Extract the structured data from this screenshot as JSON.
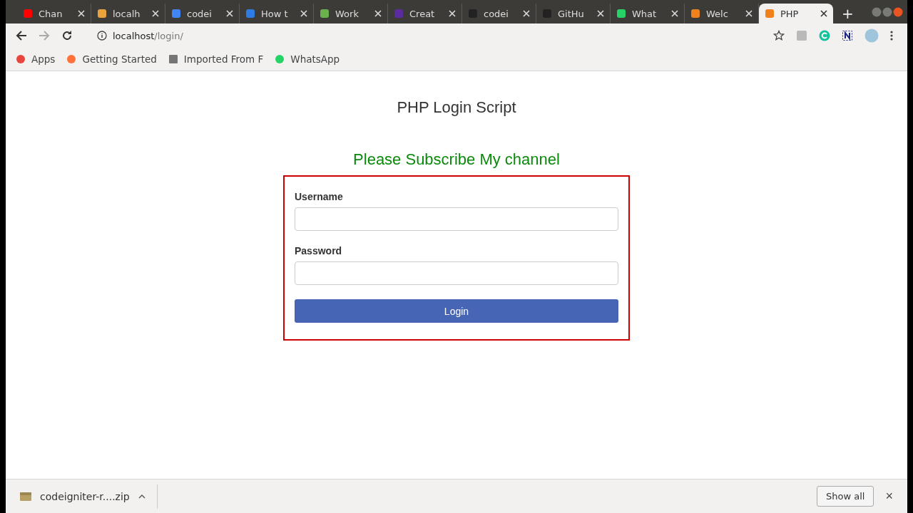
{
  "tabs": [
    {
      "title": "Chan",
      "color": "#ff0000",
      "selected": false
    },
    {
      "title": "localh",
      "color": "#e8a33d",
      "selected": false
    },
    {
      "title": "codei",
      "color": "#4285f4",
      "selected": false
    },
    {
      "title": "How t",
      "color": "#2d7be5",
      "selected": false
    },
    {
      "title": "Work",
      "color": "#6ab04c",
      "selected": false
    },
    {
      "title": "Creat",
      "color": "#5b2c9f",
      "selected": false
    },
    {
      "title": "codei",
      "color": "#222222",
      "selected": false
    },
    {
      "title": "GitHu",
      "color": "#222222",
      "selected": false
    },
    {
      "title": "What",
      "color": "#25d366",
      "selected": false
    },
    {
      "title": "Welc",
      "color": "#f0821e",
      "selected": false
    },
    {
      "title": "PHP",
      "color": "#f0821e",
      "selected": true
    }
  ],
  "new_tab": "+",
  "address": {
    "host": "localhost",
    "path": "/login/"
  },
  "bookmarks": [
    {
      "label": "Apps",
      "color": "#e8453c"
    },
    {
      "label": "Getting Started",
      "color": "#ff7139"
    },
    {
      "label": "Imported From F",
      "color": "#757575"
    },
    {
      "label": "WhatsApp",
      "color": "#25d366"
    }
  ],
  "page": {
    "title": "PHP Login Script",
    "notice": "Please Subscribe My channel",
    "fields": [
      {
        "label": "Username"
      },
      {
        "label": "Password"
      }
    ],
    "button": "Login"
  },
  "downloads": {
    "file": "codeigniter-r....zip",
    "show_all": "Show all",
    "close": "×"
  }
}
